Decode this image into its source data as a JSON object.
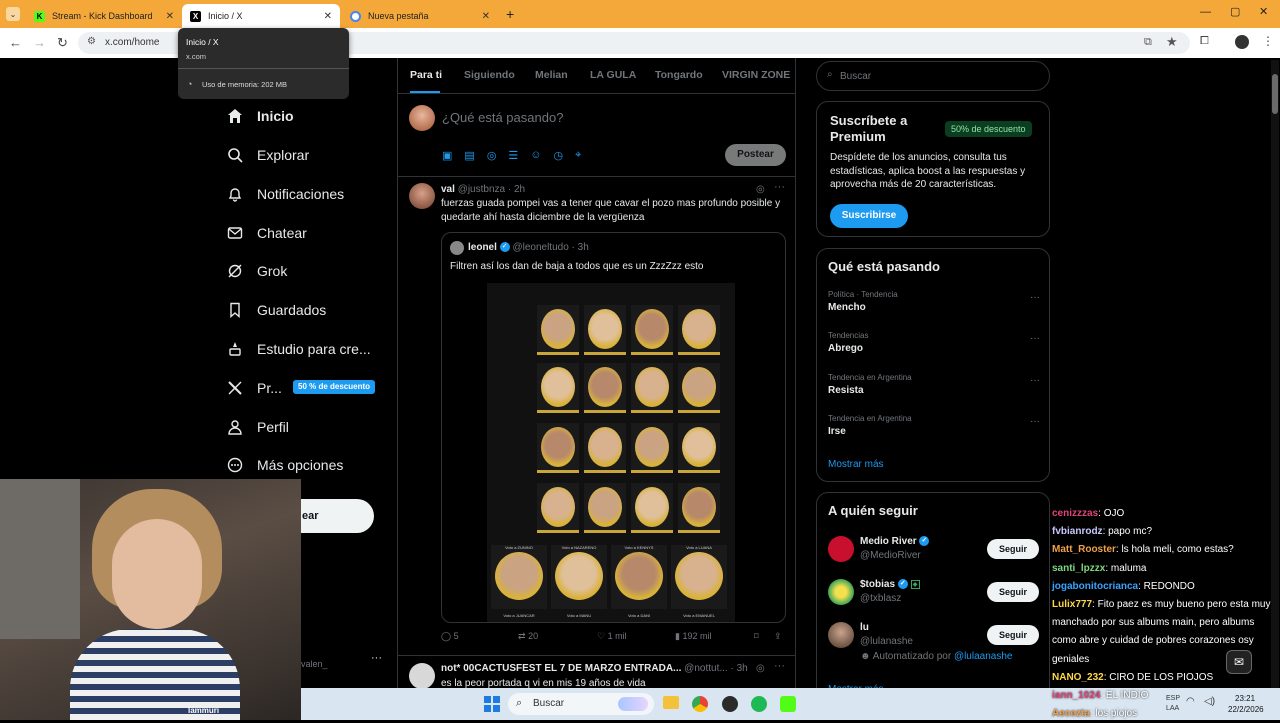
{
  "browser": {
    "tabs": [
      {
        "title": "Stream - Kick Dashboard"
      },
      {
        "title": "Inicio / X"
      },
      {
        "title": "Nueva pestaña"
      }
    ],
    "url": "x.com/home",
    "tooltip": {
      "title": "Inicio / X",
      "host": "x.com",
      "memory": "Uso de memoria: 202 MB"
    }
  },
  "nav": {
    "items": [
      {
        "label": "Inicio"
      },
      {
        "label": "Explorar"
      },
      {
        "label": "Notificaciones"
      },
      {
        "label": "Chatear"
      },
      {
        "label": "Grok"
      },
      {
        "label": "Guardados"
      },
      {
        "label": "Estudio para cre..."
      },
      {
        "label": "Pr..."
      },
      {
        "label": "Perfil"
      },
      {
        "label": "Más opciones"
      }
    ],
    "premium_badge": "50 % de descuento",
    "post_button": "ear",
    "account_handle": "valen_",
    "more": "···"
  },
  "feed": {
    "tabs": [
      "Para ti",
      "Siguiendo",
      "Melian",
      "LA GULA",
      "Tongardo",
      "VIRGIN ZONE"
    ],
    "compose_placeholder": "¿Qué está pasando?",
    "post_button": "Postear",
    "tweet1": {
      "name": "val",
      "handle": "@justbnza · 2h",
      "text": "fuerzas guada pompei vas a tener que cavar el pozo mas profundo posible y quedarte ahí hasta diciembre de la vergüenza",
      "quote": {
        "name": "leonel",
        "handle": "@leoneltudo · 3h",
        "text": "Filtren así los dan de baja a todos que es un ZzzZzz esto",
        "image_labels": [
          "Voto a ZUNINO",
          "Voto a NAZARENO",
          "Voto a KENNYS",
          "Voto a LUANA",
          "Voto a JUANCAR",
          "Voto a MANU",
          "Voto a DANI",
          "Voto a EMANUEL"
        ]
      },
      "stats": {
        "replies": "5",
        "reposts": "20",
        "likes": "1 mil",
        "views": "192 mil"
      }
    },
    "tweet2": {
      "name": "not* 00CACTUSFEST EL 7 DE MARZO ENTRADA...",
      "handle": "@nottut... · 3h",
      "text": "es la peor portada q vi en mis 19 años de vida"
    }
  },
  "right": {
    "search_placeholder": "Buscar",
    "premium": {
      "title": "Suscríbete a Premium",
      "badge": "50% de descuento",
      "body": "Despídete de los anuncios, consulta tus estadísticas, aplica boost a las respuestas y aprovecha más de 20 características.",
      "button": "Suscribirse"
    },
    "trends": {
      "title": "Qué está pasando",
      "items": [
        {
          "category": "Política · Tendencia",
          "name": "Mencho"
        },
        {
          "category": "Tendencias",
          "name": "Abrego"
        },
        {
          "category": "Tendencia en Argentina",
          "name": "Resista"
        },
        {
          "category": "Tendencia en Argentina",
          "name": "Irse"
        }
      ],
      "more": "Mostrar más"
    },
    "follow": {
      "title": "A quién seguir",
      "items": [
        {
          "name": "Medio River",
          "handle": "@MedioRiver",
          "button": "Seguir"
        },
        {
          "name": "$tobias",
          "handle": "@txblasz",
          "button": "Seguir"
        },
        {
          "name": "lu",
          "handle": "@lulanashe",
          "button": "Seguir",
          "note": "Automatizado por",
          "note_handle": "@lulaanashe"
        }
      ],
      "more": "Mostrar más"
    }
  },
  "chat": [
    {
      "user": "cenizzzas",
      "color": "#e0447a",
      "msg": ": OJO"
    },
    {
      "user": "fvbianrodz",
      "color": "#c9c9ff",
      "msg": ": papo mc?"
    },
    {
      "user": "Matt_Rooster",
      "color": "#f0a04b",
      "msg": ": ls hola meli, como estas?"
    },
    {
      "user": "santi_lpzzx",
      "color": "#7fd87f",
      "msg": ": maluma"
    },
    {
      "user": "jogabonitocrianca",
      "color": "#3aa3ff",
      "msg": ": REDONDO"
    },
    {
      "user": "Lulix777",
      "color": "#ffd84a",
      "msg": ": Fito paez es muy bueno pero esta muy manchado por sus albums main, pero albums como abre y cuidad de pobres corazones osy geniales"
    },
    {
      "user": "NANO_232",
      "color": "#ffd84a",
      "msg": ": CIRO DE LOS PIOJOS"
    },
    {
      "user": "iann_1024",
      "color": "#e0447a",
      "msg": ": EL INDIO"
    },
    {
      "user": "Aecezta",
      "color": "#f0a04b",
      "msg": ": los piojos"
    }
  ],
  "taskbar": {
    "search": "Buscar",
    "lang1": "ESP",
    "lang2": "LAA",
    "time": "23:21",
    "date": "22/2/2026"
  },
  "webcam": {
    "shirt_text": "lammuri"
  }
}
